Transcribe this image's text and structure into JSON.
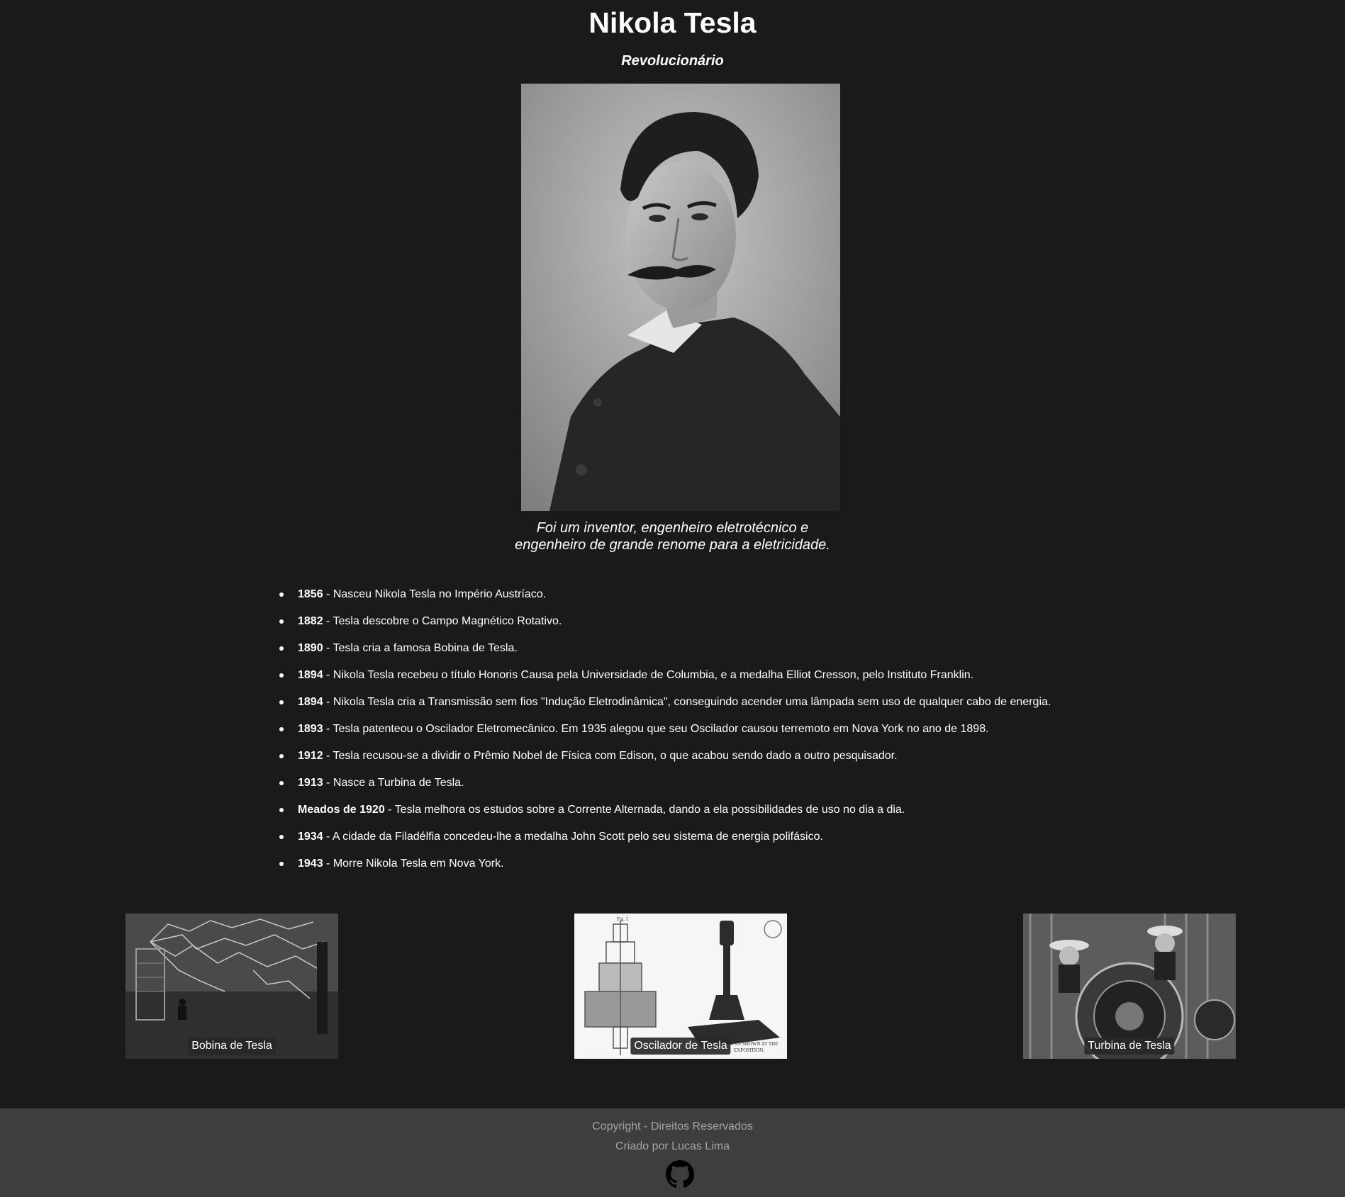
{
  "header": {
    "title": "Nikola Tesla",
    "subtitle": "Revolucionário"
  },
  "portrait": {
    "caption_line1": "Foi um inventor, engenheiro eletrotécnico e",
    "caption_line2": "engenheiro de grande renome para a eletricidade."
  },
  "timeline": [
    {
      "year": "1856",
      "text": " - Nasceu Nikola Tesla no Império Austríaco."
    },
    {
      "year": "1882",
      "text": " - Tesla descobre o Campo Magnético Rotativo."
    },
    {
      "year": "1890",
      "text": " - Tesla cria a famosa Bobina de Tesla."
    },
    {
      "year": "1894",
      "text": " - Nikola Tesla recebeu o título Honoris Causa pela Universidade de Columbia, e a medalha Elliot Cresson, pelo Instituto Franklin."
    },
    {
      "year": "1894",
      "text": " - Nikola Tesla cria a Transmissão sem fios \"Indução Eletrodinâmica\", conseguindo acender uma lâmpada sem uso de qualquer cabo de energia."
    },
    {
      "year": "1893",
      "text": " - Tesla patenteou o Oscilador Eletromecânico. Em 1935 alegou que seu Oscilador causou terremoto em Nova York no ano de 1898."
    },
    {
      "year": "1912",
      "text": " - Tesla recusou-se a dividir o Prêmio Nobel de Física com Edison, o que acabou sendo dado a outro pesquisador."
    },
    {
      "year": "1913",
      "text": " - Nasce a Turbina de Tesla."
    },
    {
      "year": "Meados de 1920",
      "text": " - Tesla melhora os estudos sobre a Corrente Alternada, dando a ela possibilidades de uso no dia a dia."
    },
    {
      "year": "1934",
      "text": " - A cidade da Filadélfia concedeu-lhe a medalha John Scott pelo seu sistema de energia polifásico."
    },
    {
      "year": "1943",
      "text": " - Morre Nikola Tesla em Nova York."
    }
  ],
  "gallery": [
    {
      "label": "Bobina de Tesla"
    },
    {
      "label": "Oscilador de Tesla"
    },
    {
      "label": "Turbina de Tesla"
    }
  ],
  "gallery_image_text": {
    "oscillator_fig": "Fig. 1",
    "oscillator_note_line1": "R AS SHOWN AT THE",
    "oscillator_note_line2": "EXPOSITION."
  },
  "footer": {
    "copyright": "Copyright - Direitos Reservados",
    "author": "Criado por Lucas Lima",
    "icon": "github-icon"
  }
}
